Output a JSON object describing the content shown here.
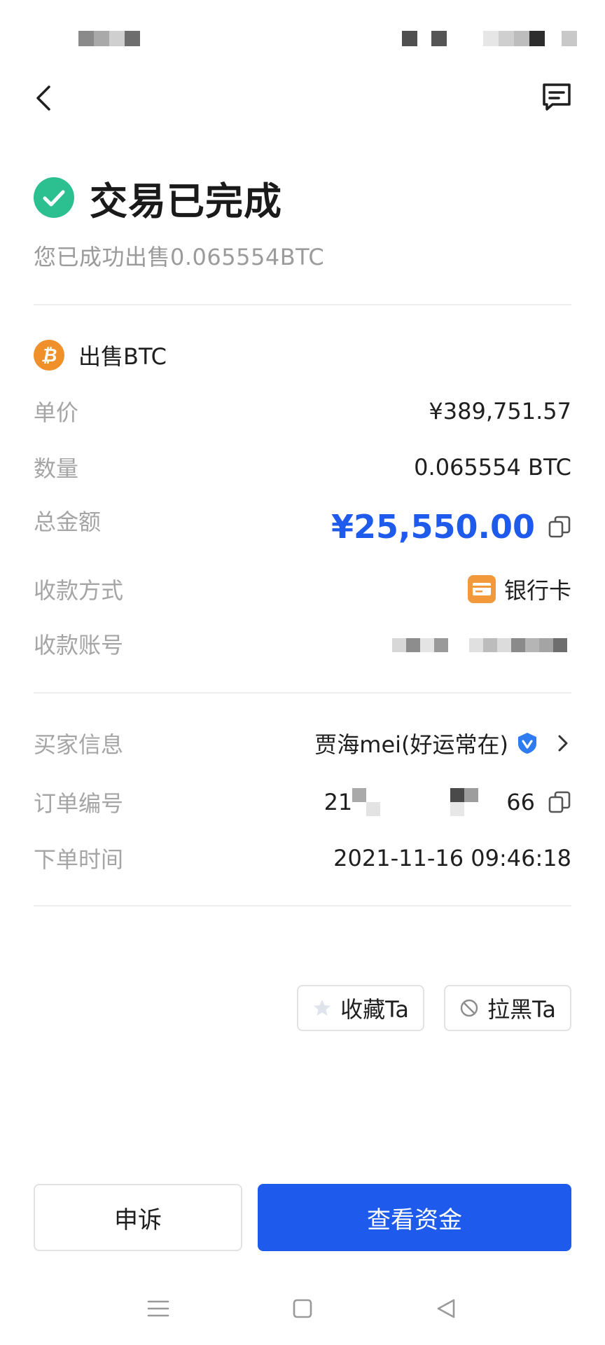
{
  "header": {
    "title": "交易已完成",
    "subtitle": "您已成功出售0.065554BTC"
  },
  "section": {
    "title": "出售BTC"
  },
  "order": {
    "unit_price_label": "单价",
    "unit_price_value": "¥389,751.57",
    "quantity_label": "数量",
    "quantity_value": "0.065554 BTC",
    "total_label": "总金额",
    "total_value": "¥25,550.00",
    "payment_method_label": "收款方式",
    "payment_method_value": "银行卡",
    "account_label": "收款账号"
  },
  "buyer": {
    "info_label": "买家信息",
    "info_value": "贾海mei(好运常在)",
    "order_no_label": "订单编号",
    "order_no_prefix": "21",
    "order_no_suffix": "66",
    "time_label": "下单时间",
    "time_value": "2021-11-16 09:46:18"
  },
  "actions": {
    "favorite_label": "收藏Ta",
    "block_label": "拉黑Ta",
    "appeal_label": "申诉",
    "view_funds_label": "查看资金"
  },
  "colors": {
    "accent": "#1e5bec",
    "success": "#2cbf8f",
    "btc": "#f0902b",
    "bank": "#f29a3b"
  },
  "icons": {
    "back": "chevron-left-icon",
    "chat": "message-icon",
    "success": "check-circle-icon",
    "btc": "bitcoin-icon",
    "copy": "copy-icon",
    "bank": "bank-card-icon",
    "verified": "verified-badge-icon",
    "chevron": "chevron-right-icon",
    "star": "star-icon",
    "block": "block-icon"
  }
}
